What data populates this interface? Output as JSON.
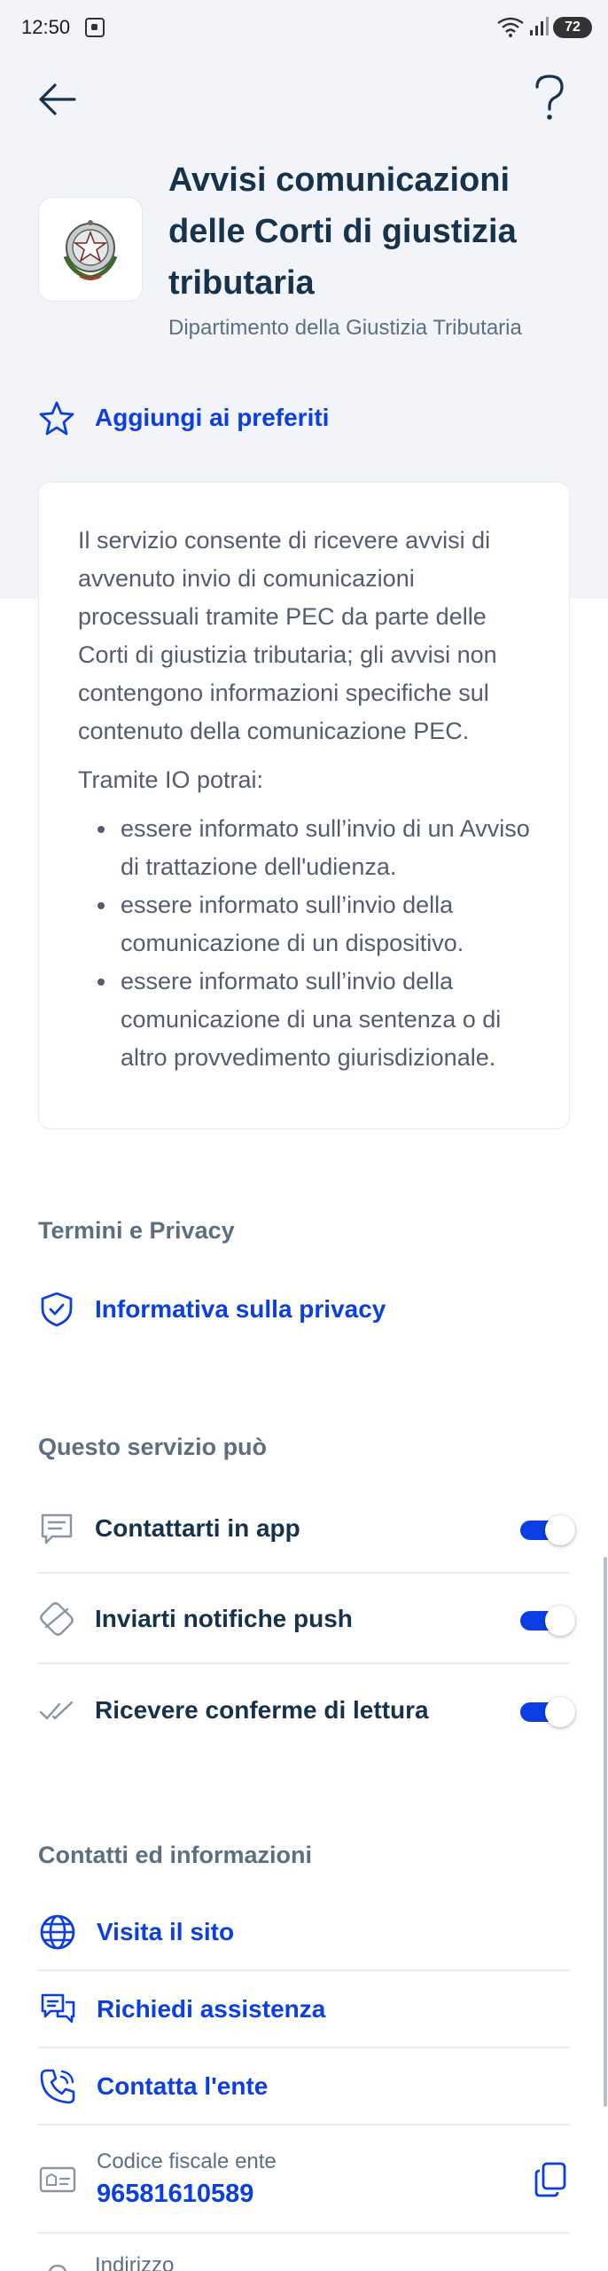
{
  "status_bar": {
    "time": "12:50",
    "battery": "72"
  },
  "header": {
    "back_icon": "arrow-left-icon",
    "help_icon": "help-icon"
  },
  "service": {
    "title": "Avvisi comunicazioni delle Corti di giustizia tributaria",
    "organization": "Dipartimento della Giustizia Tributaria",
    "logo": "italian-emblem"
  },
  "favorite": {
    "label": "Aggiungi ai preferiti",
    "icon": "star-icon"
  },
  "description": {
    "paragraph": "Il servizio consente di ricevere avvisi di avvenuto invio di comunicazioni processuali tramite PEC da parte delle Corti di giustizia tributaria; gli avvisi non contengono informazioni specifiche sul contenuto della comunicazione PEC.",
    "intro": "Tramite IO potrai:",
    "items": [
      "essere informato sull’invio di un Avviso di trattazione dell'udienza.",
      "essere informato sull’invio della comunicazione di un dispositivo.",
      "essere informato sull’invio della comunicazione di una sentenza o di altro provvedimento giurisdizionale."
    ]
  },
  "terms": {
    "title": "Termini e Privacy",
    "privacy_label": "Informativa sulla privacy"
  },
  "permissions": {
    "title": "Questo servizio può",
    "items": [
      {
        "label": "Contattarti in app",
        "icon": "message-icon",
        "enabled": true
      },
      {
        "label": "Inviarti notifiche push",
        "icon": "bell-icon",
        "enabled": true
      },
      {
        "label": "Ricevere conferme di lettura",
        "icon": "double-check-icon",
        "enabled": true
      }
    ]
  },
  "contacts": {
    "title": "Contatti ed informazioni",
    "website_label": "Visita il sito",
    "support_label": "Richiedi assistenza",
    "call_label": "Contatta l'ente",
    "fiscal_code_label": "Codice fiscale ente",
    "fiscal_code_value": "96581610589",
    "address_label": "Indirizzo"
  },
  "colors": {
    "accent": "#0b3ee3",
    "text": "#17324d",
    "muted": "#5c6f82",
    "header_bg": "#f2f4f9"
  }
}
